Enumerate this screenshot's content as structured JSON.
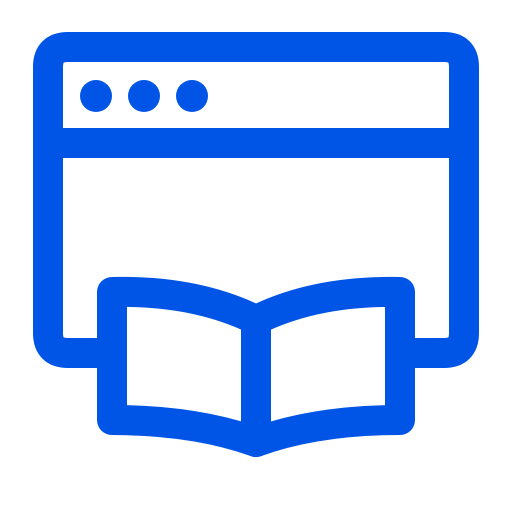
{
  "icon": {
    "name": "web-browser-with-open-book-icon",
    "stroke_color": "#0055e6",
    "background": "#ffffff"
  }
}
